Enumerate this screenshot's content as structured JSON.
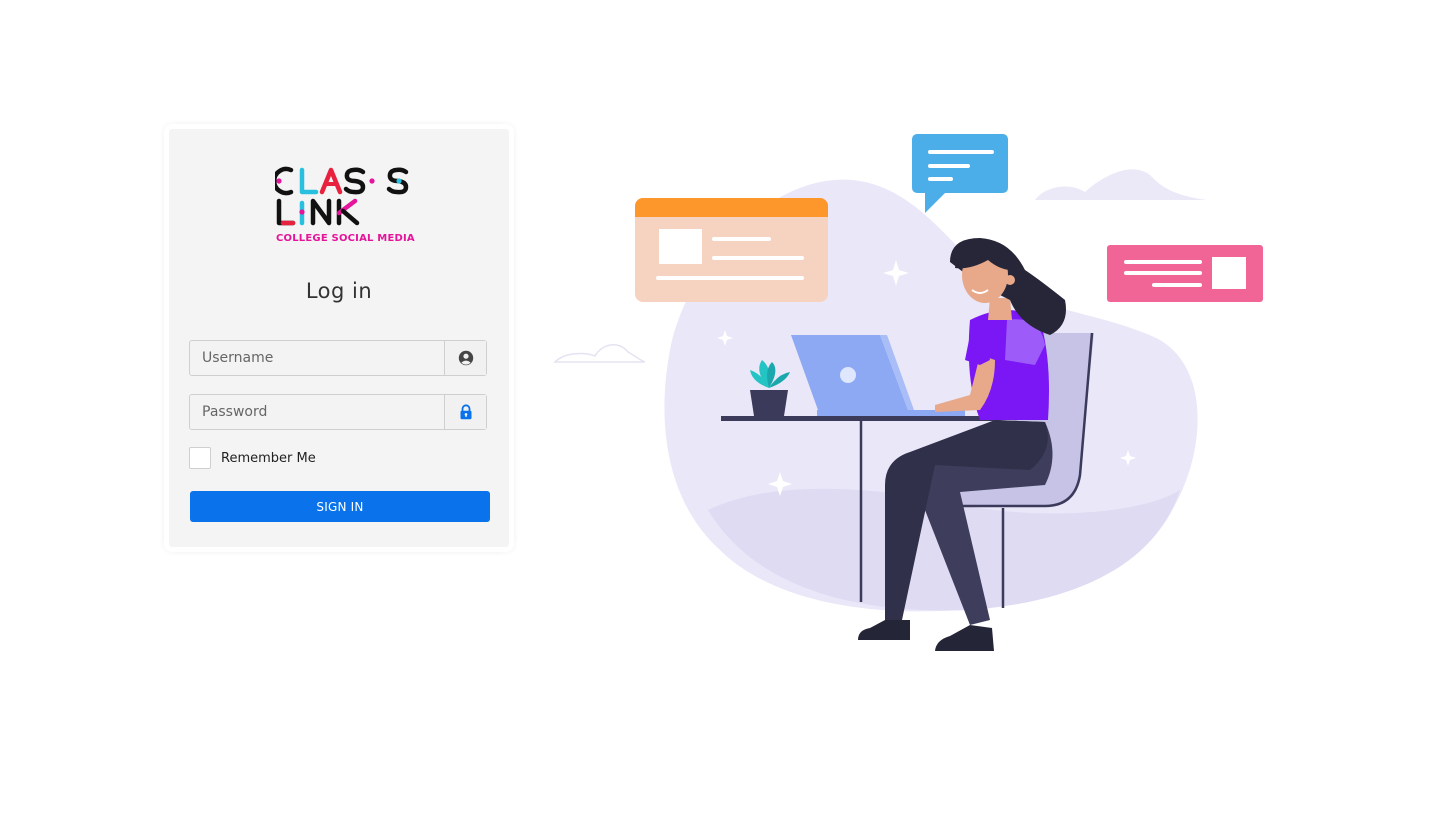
{
  "logo": {
    "line1": "CLASS",
    "line2": "LINK",
    "tagline": "COLLEGE SOCIAL MEDIA"
  },
  "login": {
    "title": "Log in",
    "username_placeholder": "Username",
    "password_placeholder": "Password",
    "remember_label": "Remember Me",
    "signin_label": "SIGN IN"
  },
  "icons": {
    "username": "user-circle-icon",
    "password": "lock-icon"
  },
  "colors": {
    "primary": "#0a72ea",
    "brand_pink": "#e6139b",
    "brand_cyan": "#29c0e0",
    "card_bg": "#f4f4f4",
    "illustration_purple": "#7b16f5"
  }
}
